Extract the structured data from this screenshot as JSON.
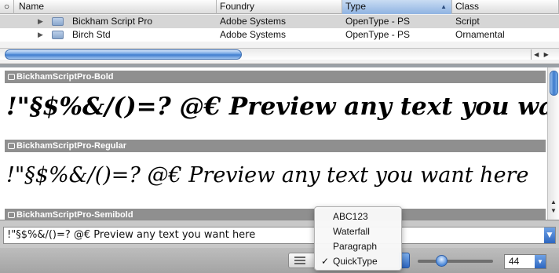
{
  "table": {
    "columns": [
      "Name",
      "Foundry",
      "Type",
      "Class"
    ],
    "header_select_icon": "radio-icon",
    "sorted_column": "Type",
    "rows": [
      {
        "name": "Bickham Script Pro",
        "foundry": "Adobe Systems",
        "type": "OpenType - PS",
        "class": "Script"
      },
      {
        "name": "Birch Std",
        "foundry": "Adobe Systems",
        "type": "OpenType - PS",
        "class": "Ornamental"
      }
    ]
  },
  "preview": {
    "samples": [
      {
        "header": "BickhamScriptPro-Bold",
        "text": "!\"§$%&/()=? @€ Preview any text you want here"
      },
      {
        "header": "BickhamScriptPro-Regular",
        "text": "!\"§$%&/()=? @€ Preview any text you want here"
      },
      {
        "header": "BickhamScriptPro-Semibold",
        "text": ""
      }
    ]
  },
  "sample_field": {
    "value": "!\"§$%&/()=? @€ Preview any text you want here"
  },
  "preview_mode_menu": {
    "items": [
      "ABC123",
      "Waterfall",
      "Paragraph",
      "QuickType"
    ],
    "selected": "QuickType",
    "check_mark": "✓"
  },
  "font_size": {
    "value": "44"
  },
  "colors": {
    "accent": "#3a79cc",
    "selected_row": "#d6d6d6",
    "sample_header": "#8f8f8f"
  }
}
